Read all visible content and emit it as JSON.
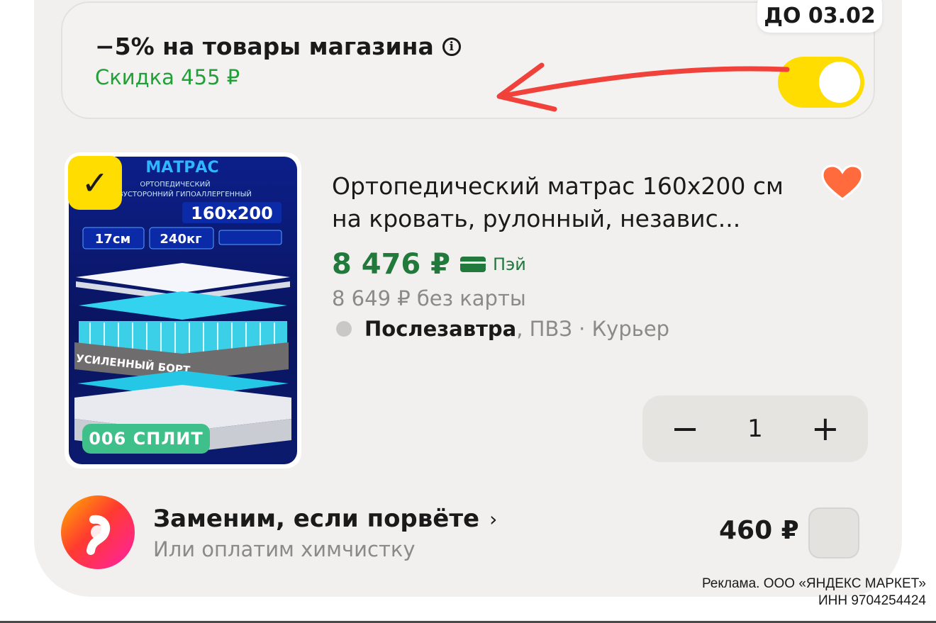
{
  "promo": {
    "title": "−5% на товары магазина",
    "discount": "Скидка 455 ₽",
    "deadline_badge": "ДО 03.02",
    "toggle_on": true
  },
  "product": {
    "image_label_brand": "МАТРАС",
    "image_label_size": "160x200",
    "image_label_height": "17см",
    "image_label_weight": "240кг",
    "image_label_board": "УСИЛЕННЫЙ БОРТ",
    "image_label_sub1": "ОРТОПЕДИЧЕСКИЙ",
    "image_label_sub2": "ДВУСТОРОННИЙ ГИПОАЛЛЕРГЕННЫЙ",
    "split_badge": "006 СПЛИТ",
    "selected": true,
    "title": "Ортопедический матрас 160x200 см на кровать, рулонный, независ...",
    "price": "8 476 ₽",
    "pay_label": "Пэй",
    "old_price": "8 649 ₽ без карты",
    "delivery_bold": "Послезавтра",
    "delivery_rest": ", ПВЗ · Курьер",
    "quantity": "1",
    "minus": "−",
    "plus": "+"
  },
  "insurance": {
    "title": "Заменим, если порвёте",
    "subtitle": "Или оплатим химчистку",
    "price": "460 ₽",
    "chevron": "›"
  },
  "ad": {
    "line1": "Реклама. ООО «ЯНДЕКС МАРКЕТ»",
    "line2": "ИНН 9704254424"
  },
  "colors": {
    "accent_yellow": "#ffdd00",
    "price_green": "#217a3c",
    "discount_green": "#21a038",
    "heart": "#ff6b3d",
    "arrow_red": "#f0413b"
  },
  "icons": {
    "info": "info-icon",
    "heart": "heart-icon",
    "check": "checkmark-icon",
    "card": "card-icon",
    "chevron": "chevron-right-icon"
  }
}
